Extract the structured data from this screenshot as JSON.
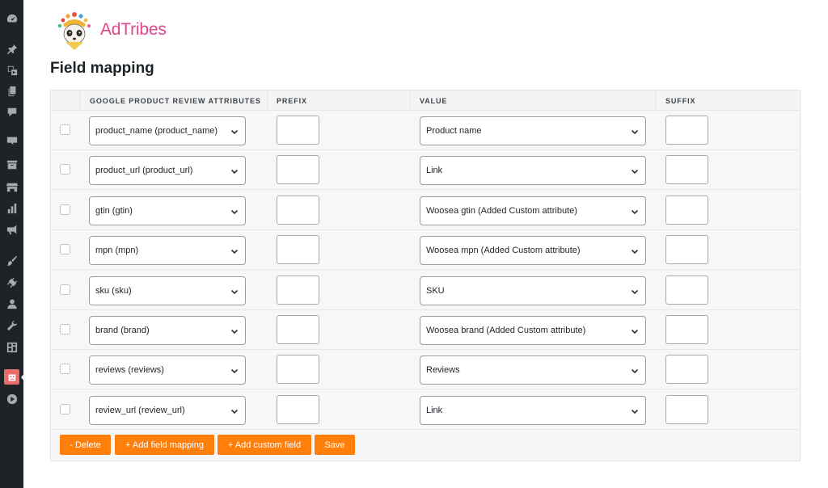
{
  "brand": {
    "name": "AdTribes"
  },
  "page": {
    "title": "Field mapping"
  },
  "table": {
    "headers": {
      "attributes": "GOOGLE PRODUCT REVIEW ATTRIBUTES",
      "prefix": "PREFIX",
      "value": "VALUE",
      "suffix": "SUFFIX"
    },
    "rows": [
      {
        "attribute": "product_name (product_name)",
        "prefix": "",
        "value": "Product name",
        "suffix": ""
      },
      {
        "attribute": "product_url (product_url)",
        "prefix": "",
        "value": "Link",
        "suffix": ""
      },
      {
        "attribute": "gtin (gtin)",
        "prefix": "",
        "value": "Woosea gtin (Added Custom attribute)",
        "suffix": ""
      },
      {
        "attribute": "mpn (mpn)",
        "prefix": "",
        "value": "Woosea mpn (Added Custom attribute)",
        "suffix": ""
      },
      {
        "attribute": "sku (sku)",
        "prefix": "",
        "value": "SKU",
        "suffix": ""
      },
      {
        "attribute": "brand (brand)",
        "prefix": "",
        "value": "Woosea brand (Added Custom attribute)",
        "suffix": ""
      },
      {
        "attribute": "reviews (reviews)",
        "prefix": "",
        "value": "Reviews",
        "suffix": ""
      },
      {
        "attribute": "review_url (review_url)",
        "prefix": "",
        "value": "Link",
        "suffix": ""
      }
    ]
  },
  "actions": {
    "delete": "- Delete",
    "add_field_mapping": "+ Add field mapping",
    "add_custom_field": "+ Add custom field",
    "save": "Save"
  },
  "colors": {
    "accent": "#ff7f0a",
    "brand": "#e2468c",
    "sidebar": "#1d2327"
  },
  "sidebar_icons": [
    "dashboard-icon",
    "pin-icon",
    "media-icon",
    "pages-icon",
    "comments-icon",
    "woo-icon",
    "products-icon",
    "store-icon",
    "analytics-icon",
    "marketing-icon",
    "appearance-icon",
    "plugins-icon",
    "users-icon",
    "tools-icon",
    "settings-icon",
    "adtribes-icon",
    "play-icon"
  ]
}
